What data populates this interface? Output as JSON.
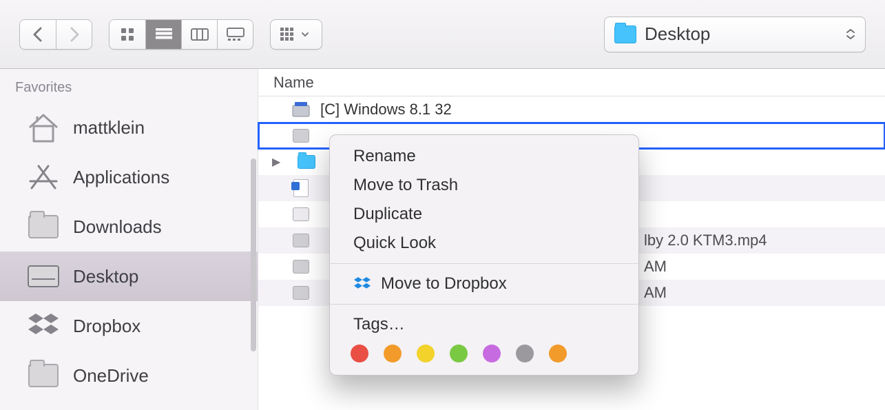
{
  "toolbar": {
    "path_label": "Desktop"
  },
  "sidebar": {
    "section_label": "Favorites",
    "items": [
      {
        "label": "mattklein"
      },
      {
        "label": "Applications"
      },
      {
        "label": "Downloads"
      },
      {
        "label": "Desktop"
      },
      {
        "label": "Dropbox"
      },
      {
        "label": "OneDrive"
      }
    ]
  },
  "filelist": {
    "column_header": "Name",
    "rows": [
      {
        "name": "[C] Windows 8.1 32"
      },
      {
        "name": ""
      },
      {
        "name": ""
      },
      {
        "name": ""
      },
      {
        "name": ""
      },
      {
        "name": "",
        "peek": "lby 2.0   KTM3.mp4"
      },
      {
        "name": "",
        "peek": "AM"
      },
      {
        "name": "",
        "peek": "AM"
      }
    ]
  },
  "context_menu": {
    "items": {
      "rename": "Rename",
      "move_to_trash": "Move to Trash",
      "duplicate": "Duplicate",
      "quick_look": "Quick Look",
      "move_to_dropbox": "Move to Dropbox",
      "tags": "Tags…"
    },
    "tag_colors": [
      "#e94f45",
      "#f29b2b",
      "#f2d22b",
      "#7ac943",
      "#c76be0",
      "#9b999d",
      "#f29b2b"
    ]
  }
}
